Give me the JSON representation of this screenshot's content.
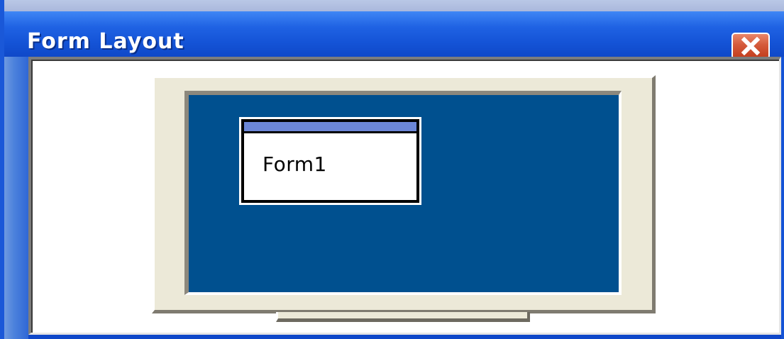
{
  "window": {
    "title": "Form Layout"
  },
  "preview": {
    "form_caption": "Form1"
  },
  "icons": {
    "close": "close-icon"
  },
  "colors": {
    "titlebar": "#1f62e3",
    "close_button": "#d45a3b",
    "screen": "#00508f",
    "monitor_bezel": "#ece9d8",
    "form_titlebar": "#6b86d6"
  }
}
